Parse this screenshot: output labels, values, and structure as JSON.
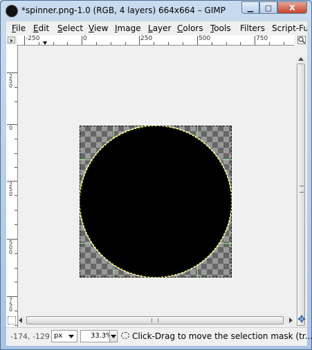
{
  "window": {
    "title": "*spinner.png-1.0 (RGB, 4 layers) 664x664 – GIMP",
    "minimize_label": "▁",
    "maximize_label": "▢",
    "close_label": "X"
  },
  "menu": {
    "items": [
      {
        "accel": "F",
        "rest": "ile"
      },
      {
        "accel": "E",
        "rest": "dit"
      },
      {
        "accel": "S",
        "rest": "elect"
      },
      {
        "accel": "V",
        "rest": "iew"
      },
      {
        "accel": "I",
        "rest": "mage"
      },
      {
        "accel": "L",
        "rest": "ayer"
      },
      {
        "accel": "C",
        "rest": "olors"
      },
      {
        "accel": "T",
        "rest": "ools"
      },
      {
        "accel": "",
        "rest": "Filters"
      },
      {
        "accel": "",
        "rest": "Script-Fu"
      }
    ]
  },
  "ruler": {
    "h_labels": [
      "-250",
      "0",
      "250",
      "500",
      "750"
    ],
    "v_labels": [
      "2\n5\n0",
      "0",
      "2\n5\n0",
      "5\n0\n0",
      "7\n5\n0"
    ]
  },
  "status": {
    "coords": "-174, -129",
    "unit": "px",
    "zoom": "33.3%",
    "message": "Click-Drag to move the selection mask (tr..."
  },
  "colors": {
    "window_frame": "#a9c4e3",
    "selection_marching": "#ffff00"
  },
  "icons": {
    "app": "gimp-wilber-icon",
    "navigate": "navigate-icon",
    "quickmask": "quick-mask-icon",
    "move": "move-cross-icon",
    "ellipse_select": "ellipse-select-icon"
  }
}
